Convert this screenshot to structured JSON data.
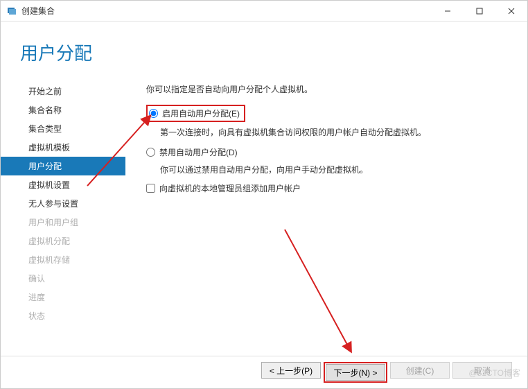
{
  "window": {
    "title": "创建集合",
    "minimize": "–",
    "maximize": "☐",
    "close": "✕"
  },
  "header": {
    "title": "用户分配"
  },
  "sidebar": {
    "items": [
      {
        "label": "开始之前",
        "selected": false,
        "disabled": false
      },
      {
        "label": "集合名称",
        "selected": false,
        "disabled": false
      },
      {
        "label": "集合类型",
        "selected": false,
        "disabled": false
      },
      {
        "label": "虚拟机模板",
        "selected": false,
        "disabled": false
      },
      {
        "label": "用户分配",
        "selected": true,
        "disabled": false
      },
      {
        "label": "虚拟机设置",
        "selected": false,
        "disabled": false
      },
      {
        "label": "无人参与设置",
        "selected": false,
        "disabled": false
      },
      {
        "label": "用户和用户组",
        "selected": false,
        "disabled": true
      },
      {
        "label": "虚拟机分配",
        "selected": false,
        "disabled": true
      },
      {
        "label": "虚拟机存储",
        "selected": false,
        "disabled": true
      },
      {
        "label": "确认",
        "selected": false,
        "disabled": true
      },
      {
        "label": "进度",
        "selected": false,
        "disabled": true
      },
      {
        "label": "状态",
        "selected": false,
        "disabled": true
      }
    ]
  },
  "form": {
    "intro": "你可以指定是否自动向用户分配个人虚拟机。",
    "radio_enable": "启用自动用户分配(E)",
    "radio_enable_desc": "第一次连接时，向具有虚拟机集合访问权限的用户帐户自动分配虚拟机。",
    "radio_disable": "禁用自动用户分配(D)",
    "radio_disable_desc": "你可以通过禁用自动用户分配，向用户手动分配虚拟机。",
    "checkbox_admin": "向虚拟机的本地管理员组添加用户帐户"
  },
  "footer": {
    "prev": "< 上一步(P)",
    "next": "下一步(N) >",
    "create": "创建(C)",
    "cancel": "取消"
  },
  "watermark": "@51CTO博客"
}
